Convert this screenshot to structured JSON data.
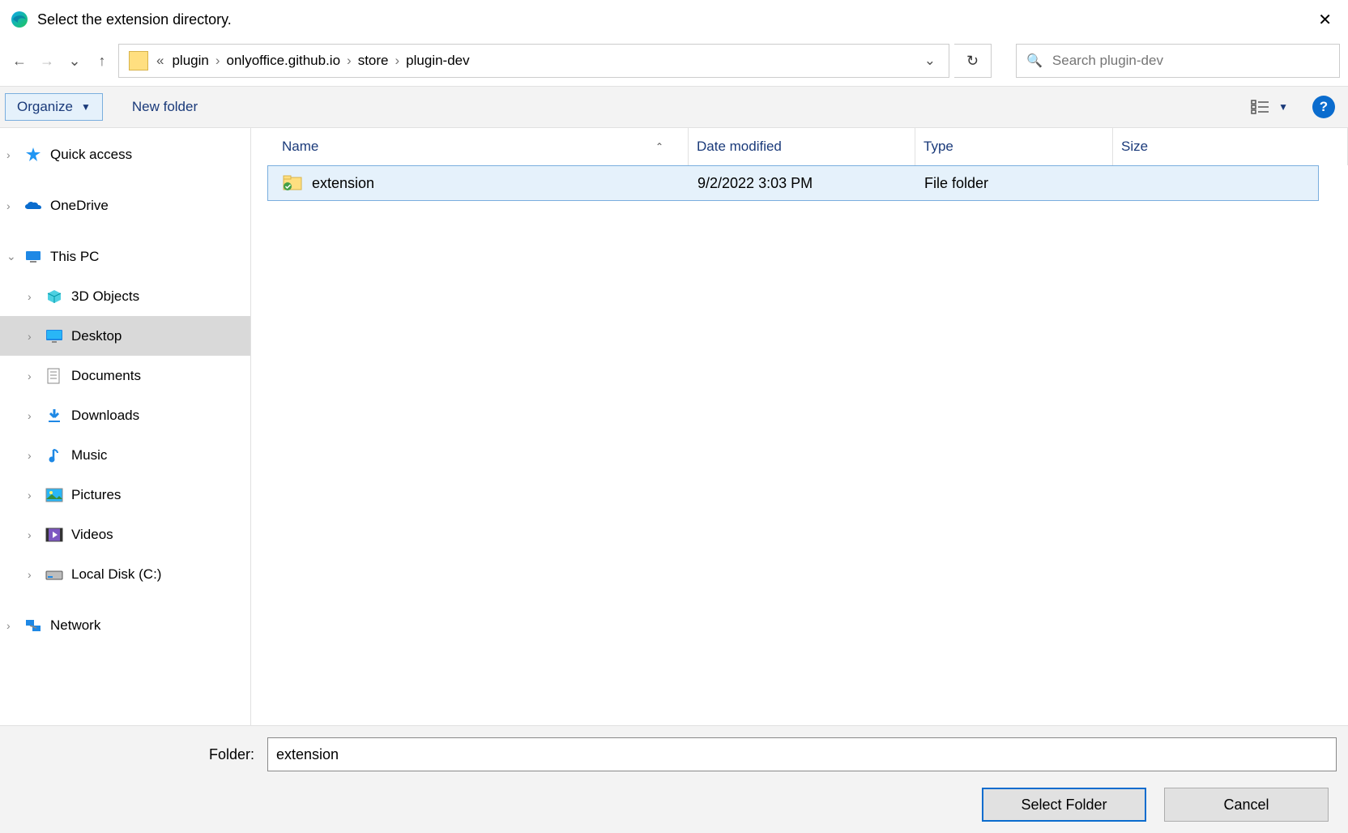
{
  "title": "Select the extension directory.",
  "nav": {
    "breadcrumb_prefix": "«",
    "segments": [
      "plugin",
      "onlyoffice.github.io",
      "store",
      "plugin-dev"
    ]
  },
  "search": {
    "placeholder": "Search plugin-dev"
  },
  "toolbar": {
    "organize_label": "Organize",
    "newfolder_label": "New folder"
  },
  "sidebar": {
    "items": [
      {
        "label": "Quick access"
      },
      {
        "label": "OneDrive"
      },
      {
        "label": "This PC"
      },
      {
        "label": "3D Objects"
      },
      {
        "label": "Desktop"
      },
      {
        "label": "Documents"
      },
      {
        "label": "Downloads"
      },
      {
        "label": "Music"
      },
      {
        "label": "Pictures"
      },
      {
        "label": "Videos"
      },
      {
        "label": "Local Disk (C:)"
      },
      {
        "label": "Network"
      }
    ]
  },
  "columns": {
    "name": "Name",
    "date": "Date modified",
    "type": "Type",
    "size": "Size"
  },
  "files": [
    {
      "name": "extension",
      "date": "9/2/2022 3:03 PM",
      "type": "File folder"
    }
  ],
  "bottom": {
    "folder_label": "Folder:",
    "folder_value": "extension",
    "select_label": "Select Folder",
    "cancel_label": "Cancel"
  }
}
